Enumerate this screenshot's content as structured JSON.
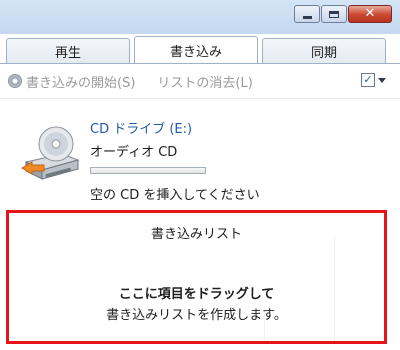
{
  "window": {
    "minimize_icon": "minimize-icon",
    "maximize_icon": "maximize-icon",
    "close_icon": "close-icon",
    "close_glyph": "✕"
  },
  "tabs": [
    {
      "label": "再生",
      "active": false
    },
    {
      "label": "書き込み",
      "active": true
    },
    {
      "label": "同期",
      "active": false
    }
  ],
  "toolbar": {
    "start_burn_label": "書き込みの開始(S)",
    "clear_list_label": "リストの消去(L)",
    "options_check": "✓",
    "disabled_color": "#9a9a9a"
  },
  "drive": {
    "title": "CD ドライブ (E:)",
    "type": "オーディオ CD",
    "prompt": "空の CD を挿入してください",
    "capacity_used": 0,
    "icon": "cd-drive-icon"
  },
  "burn_list": {
    "title": "書き込みリスト",
    "hint_main": "ここに項目をドラッグして",
    "hint_sub": "書き込みリストを作成します。",
    "highlight_color": "#e4141a"
  }
}
